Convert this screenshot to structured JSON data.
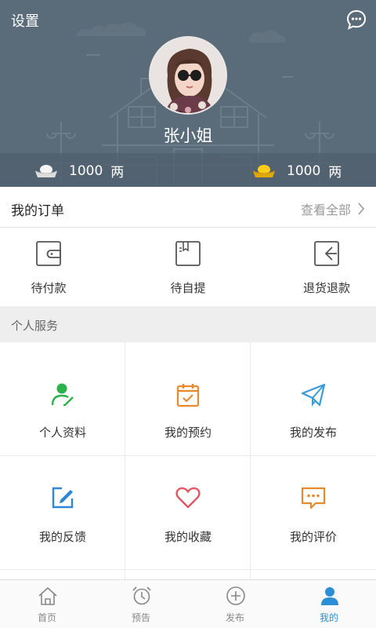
{
  "header": {
    "settings_label": "设置",
    "username": "张小姐",
    "silver": {
      "amount": "1000",
      "unit": "两"
    },
    "gold": {
      "amount": "1000",
      "unit": "两"
    }
  },
  "orders": {
    "title": "我的订单",
    "view_all": "查看全部",
    "items": [
      {
        "label": "待付款",
        "icon": "wallet-icon"
      },
      {
        "label": "待自提",
        "icon": "book-icon"
      },
      {
        "label": "退货退款",
        "icon": "return-icon"
      }
    ]
  },
  "services": {
    "title": "个人服务",
    "items": [
      {
        "label": "个人资料",
        "icon": "user-edit-icon",
        "color": "#2bb24c"
      },
      {
        "label": "我的预约",
        "icon": "calendar-check-icon",
        "color": "#e8892c"
      },
      {
        "label": "我的发布",
        "icon": "paper-plane-icon",
        "color": "#3b9bd8"
      },
      {
        "label": "我的反馈",
        "icon": "edit-icon",
        "color": "#2f86d4"
      },
      {
        "label": "我的收藏",
        "icon": "heart-icon",
        "color": "#e25563"
      },
      {
        "label": "我的评价",
        "icon": "chat-icon",
        "color": "#e8892c"
      }
    ]
  },
  "tabbar": {
    "items": [
      {
        "label": "首页",
        "icon": "home-icon"
      },
      {
        "label": "预告",
        "icon": "alarm-clock-icon"
      },
      {
        "label": "发布",
        "icon": "plus-circle-icon"
      },
      {
        "label": "我的",
        "icon": "person-icon",
        "active": true
      }
    ],
    "active_color": "#2c8fd6",
    "inactive_color": "#888888"
  }
}
